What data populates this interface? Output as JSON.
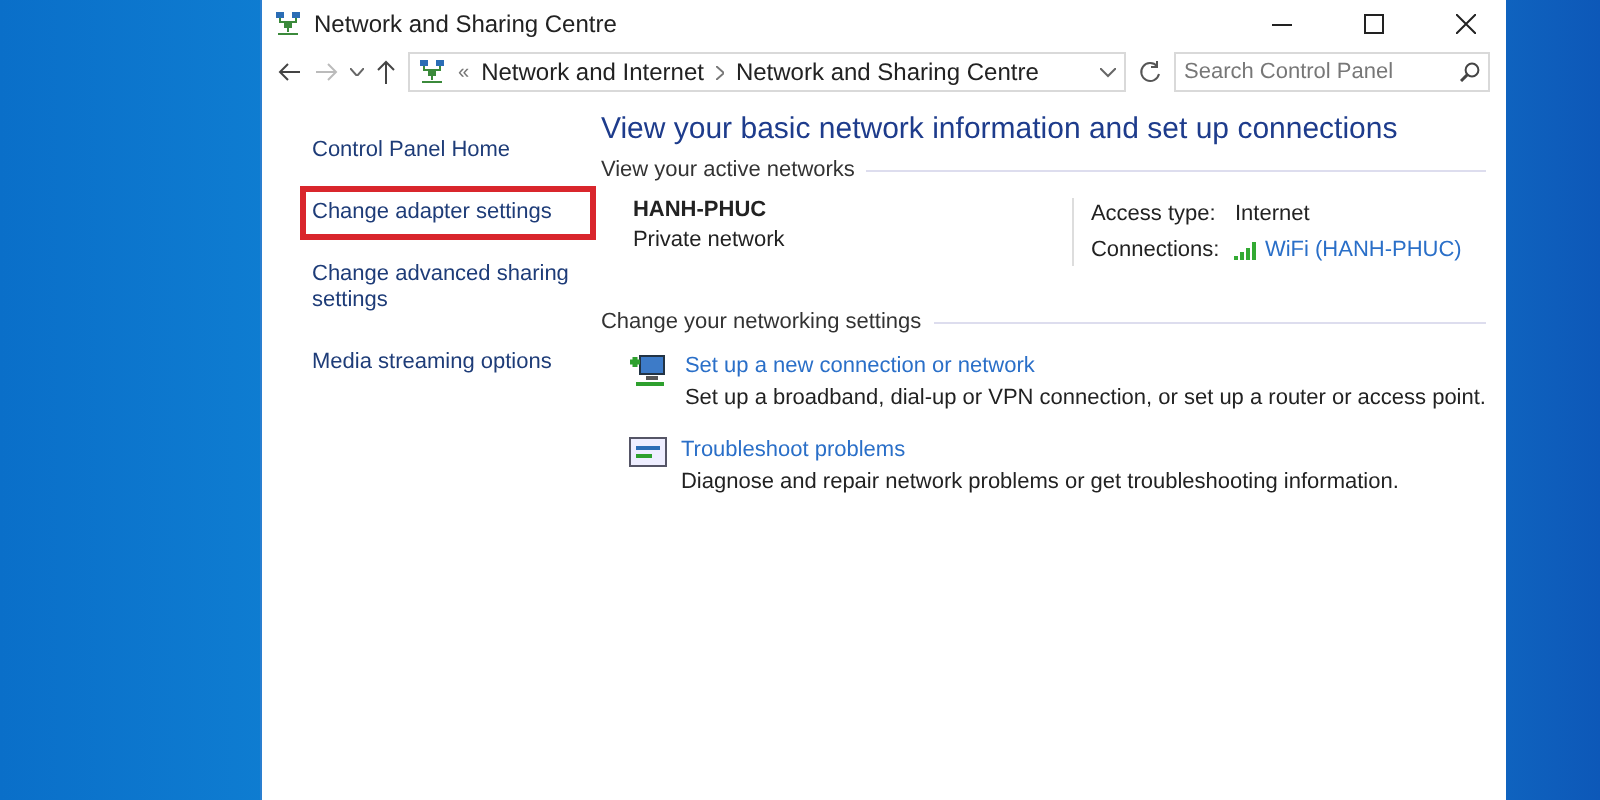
{
  "window": {
    "title": "Network and Sharing Centre"
  },
  "address_bar": {
    "overflow": "«",
    "path": [
      "Network and Internet",
      "Network and Sharing Centre"
    ],
    "search": {
      "placeholder": "Search Control Panel"
    }
  },
  "sidebar": {
    "items": [
      {
        "label": "Control Panel Home",
        "highlighted": false
      },
      {
        "label": "Change adapter settings",
        "highlighted": true
      },
      {
        "label": "Change advanced sharing settings",
        "highlighted": false
      },
      {
        "label": "Media streaming options",
        "highlighted": false
      }
    ]
  },
  "main": {
    "heading": "View your basic network information and set up connections",
    "active_networks": {
      "title": "View your active networks",
      "name": "HANH-PHUC",
      "type": "Private network",
      "access_type_label": "Access type:",
      "access_type": "Internet",
      "connections_label": "Connections:",
      "connection": "WiFi (HANH-PHUC)"
    },
    "settings": {
      "title": "Change your networking settings",
      "tasks": [
        {
          "kind": "new-connection",
          "link": "Set up a new connection or network",
          "description": "Set up a broadband, dial-up or VPN connection, or set up a router or access point."
        },
        {
          "kind": "troubleshoot",
          "link": "Troubleshoot problems",
          "description": "Diagnose and repair network problems or get troubleshooting information."
        }
      ]
    }
  }
}
